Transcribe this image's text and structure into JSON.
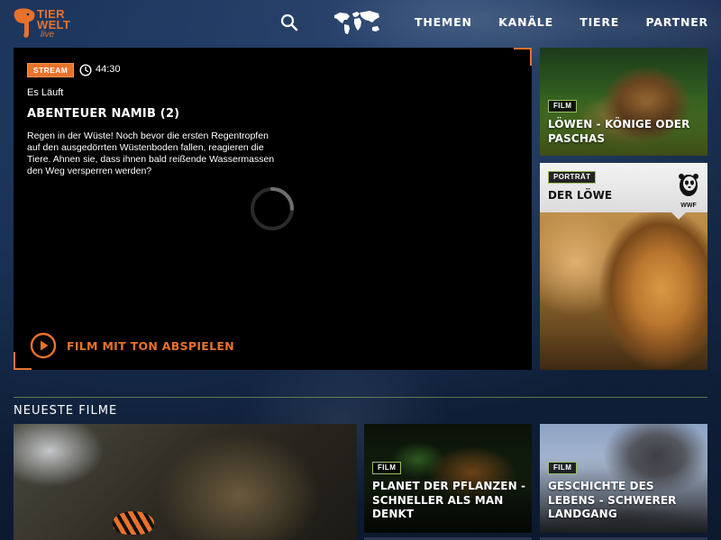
{
  "brand": {
    "logo_line1": "TIER",
    "logo_line2": "WELT",
    "logo_line3": "live",
    "accent_color": "#e8722c",
    "secondary_accent": "#9ac15d"
  },
  "header": {
    "search_icon": "search-icon",
    "map_icon": "world-map-icon",
    "nav": [
      {
        "label": "THEMEN"
      },
      {
        "label": "KANÄLE"
      },
      {
        "label": "TIERE"
      },
      {
        "label": "PARTNER"
      }
    ]
  },
  "player": {
    "badge": "STREAM",
    "duration": "44:30",
    "status": "Es Läuft",
    "title": "ABENTEUER NAMIB (2)",
    "description": "Regen in der Wüste! Noch bevor die ersten Regentropfen auf den ausgedörrten Wüstenboden fallen, reagieren die Tiere. Ahnen sie, dass ihnen bald reißende Wassermassen den Weg versperren werden?",
    "play_label": "FILM MIT TON ABSPIELEN"
  },
  "side_cards": [
    {
      "badge": "FILM",
      "title": "LÖWEN - KÖNIGE ODER PASCHAS"
    },
    {
      "badge": "PORTRÄT",
      "title": "DER LÖWE",
      "partner_logo": "wwf-panda-icon",
      "partner_text": "WWF"
    }
  ],
  "section": {
    "title": "NEUESTE FILME",
    "cards": [
      {
        "badge": "FILM",
        "title": "PLANET DER PFLANZEN - SCHNELLER ALS MAN DENKT"
      },
      {
        "badge": "FILM",
        "title": "GESCHICHTE DES LEBENS - SCHWERER LANDGANG"
      }
    ]
  }
}
